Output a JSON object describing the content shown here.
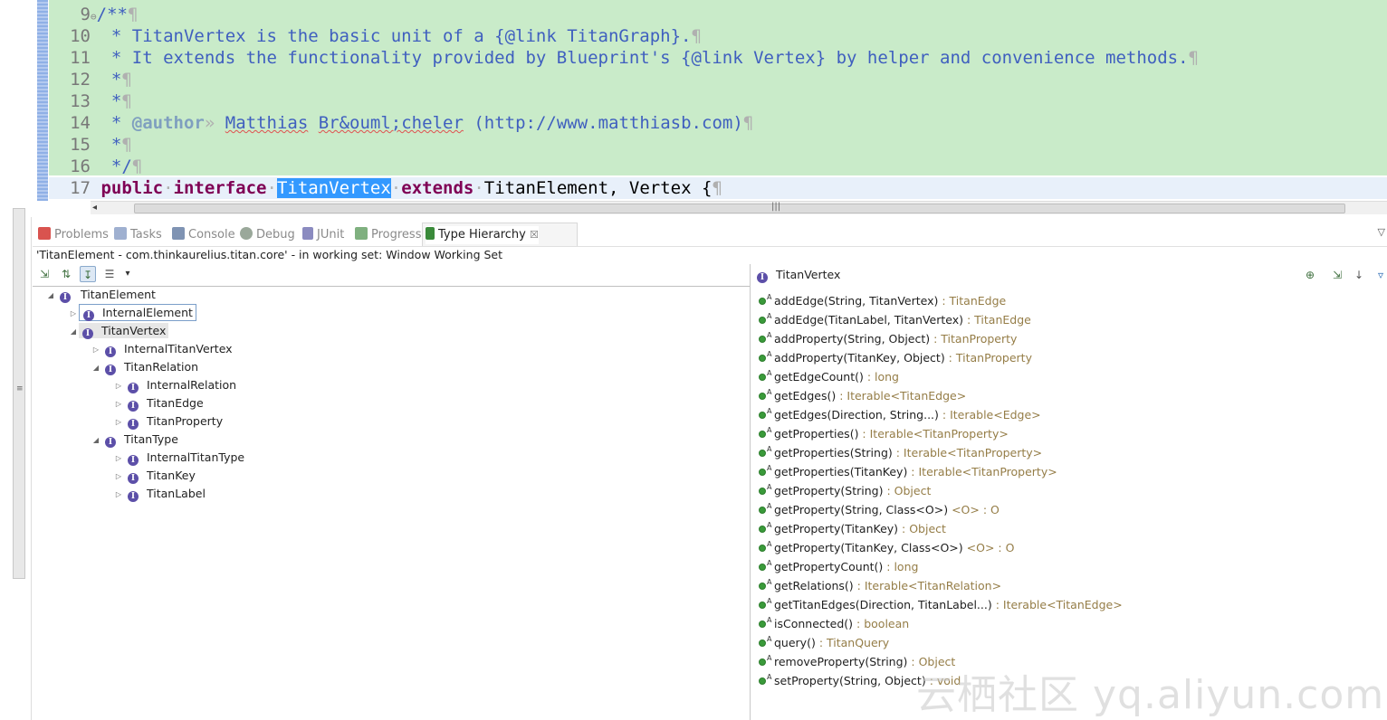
{
  "editor": {
    "lines": [
      {
        "n": "9",
        "fold": "⊖"
      },
      {
        "n": "10"
      },
      {
        "n": "11"
      },
      {
        "n": "12"
      },
      {
        "n": "13"
      },
      {
        "n": "14"
      },
      {
        "n": "15"
      },
      {
        "n": "16"
      },
      {
        "n": "17"
      }
    ],
    "l9": "/**",
    "l10_a": " * TitanVertex is the basic unit of a {@link TitanGraph}.",
    "l11_a": " * It extends the functionality provided by Blueprint's {@link Vertex} by helper and convenience methods.",
    "l12": " *",
    "l13": " *",
    "l14_tag": "@author",
    "l14_name1": "Matthias",
    "l14_name2": "Br&ouml;cheler",
    "l14_url": "(http://www.matthiasb.com)",
    "l15": " *",
    "l16": " */",
    "l17_kw1": "public",
    "l17_kw2": "interface",
    "l17_sel": "TitanVertex",
    "l17_kw3": "extends",
    "l17_rest": "TitanElement, Vertex {",
    "pilcrow": "¶"
  },
  "tabs": [
    {
      "label": "Problems",
      "icon": "problems-icon",
      "color": "#c0392b"
    },
    {
      "label": "Tasks",
      "icon": "tasks-icon",
      "color": "#7a8fb8"
    },
    {
      "label": "Console",
      "icon": "console-icon",
      "color": "#5a6f8f"
    },
    {
      "label": "Debug",
      "icon": "debug-icon",
      "color": "#7a8a7a"
    },
    {
      "label": "JUnit",
      "icon": "junit-icon",
      "color": "#5a5a9a"
    },
    {
      "label": "Progress",
      "icon": "progress-icon",
      "color": "#4f8a4f"
    },
    {
      "label": "Type Hierarchy",
      "icon": "type-hierarchy-icon",
      "color": "#3a8a3a",
      "active": true,
      "close": "☒"
    }
  ],
  "hierarchy": {
    "status": "'TitanElement - com.thinkaurelius.titan.core' - in working set: Window Working Set",
    "tree": [
      {
        "label": "TitanElement",
        "twisty": "◢",
        "depth": 0
      },
      {
        "label": "InternalElement",
        "twisty": "▷",
        "depth": 1,
        "boxed": true
      },
      {
        "label": "TitanVertex",
        "twisty": "◢",
        "depth": 1,
        "selected": true
      },
      {
        "label": "InternalTitanVertex",
        "twisty": "▷",
        "depth": 2
      },
      {
        "label": "TitanRelation",
        "twisty": "◢",
        "depth": 2
      },
      {
        "label": "InternalRelation",
        "twisty": "▷",
        "depth": 3
      },
      {
        "label": "TitanEdge",
        "twisty": "▷",
        "depth": 3
      },
      {
        "label": "TitanProperty",
        "twisty": "▷",
        "depth": 3
      },
      {
        "label": "TitanType",
        "twisty": "◢",
        "depth": 2
      },
      {
        "label": "InternalTitanType",
        "twisty": "▷",
        "depth": 3
      },
      {
        "label": "TitanKey",
        "twisty": "▷",
        "depth": 3
      },
      {
        "label": "TitanLabel",
        "twisty": "▷",
        "depth": 3
      }
    ],
    "members_title": "TitanVertex",
    "members": [
      {
        "sig": "addEdge(String, TitanVertex)",
        "ret": " : TitanEdge"
      },
      {
        "sig": "addEdge(TitanLabel, TitanVertex)",
        "ret": " : TitanEdge"
      },
      {
        "sig": "addProperty(String, Object)",
        "ret": " : TitanProperty"
      },
      {
        "sig": "addProperty(TitanKey, Object)",
        "ret": " : TitanProperty"
      },
      {
        "sig": "getEdgeCount()",
        "ret": " : long"
      },
      {
        "sig": "getEdges()",
        "ret": " : Iterable<TitanEdge>"
      },
      {
        "sig": "getEdges(Direction, String...)",
        "ret": " : Iterable<Edge>"
      },
      {
        "sig": "getProperties()",
        "ret": " : Iterable<TitanProperty>"
      },
      {
        "sig": "getProperties(String)",
        "ret": " : Iterable<TitanProperty>"
      },
      {
        "sig": "getProperties(TitanKey)",
        "ret": " : Iterable<TitanProperty>"
      },
      {
        "sig": "getProperty(String)",
        "ret": " : Object"
      },
      {
        "sig": "getProperty(String, Class<O>)",
        "ret": " <O> : O"
      },
      {
        "sig": "getProperty(TitanKey)",
        "ret": " : Object"
      },
      {
        "sig": "getProperty(TitanKey, Class<O>)",
        "ret": " <O> : O"
      },
      {
        "sig": "getPropertyCount()",
        "ret": " : long"
      },
      {
        "sig": "getRelations()",
        "ret": " : Iterable<TitanRelation>"
      },
      {
        "sig": "getTitanEdges(Direction, TitanLabel...)",
        "ret": " : Iterable<TitanEdge>"
      },
      {
        "sig": "isConnected()",
        "ret": " : boolean"
      },
      {
        "sig": "query()",
        "ret": " : TitanQuery"
      },
      {
        "sig": "removeProperty(String)",
        "ret": " : Object"
      },
      {
        "sig": "setProperty(String, Object)",
        "ret": " : void"
      }
    ]
  },
  "watermark": "云栖社区 yq.aliyun.com",
  "glyphs": {
    "abstract": "A",
    "interface": "I",
    "menu": "▾",
    "view_menu": "▽",
    "scroll_left": "◂",
    "grip": "|||"
  }
}
